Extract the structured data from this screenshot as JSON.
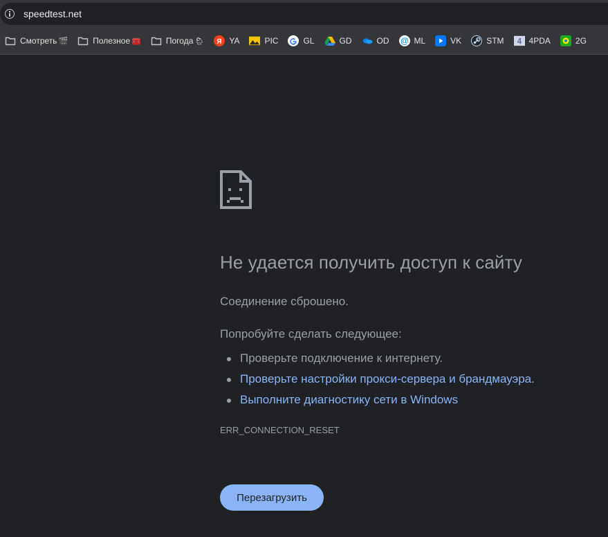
{
  "omnibox": {
    "url": "speedtest.net"
  },
  "bookmarks": [
    {
      "label": "Смотреть",
      "emoji": "🎬",
      "icon": "folder-icon"
    },
    {
      "label": "Полезное",
      "emoji": "🧰",
      "icon": "folder-icon"
    },
    {
      "label": "Погода",
      "emoji": "🌦",
      "icon": "folder-icon"
    },
    {
      "label": "YA",
      "icon": "yandex-icon",
      "color": "#fc3f1d"
    },
    {
      "label": "PIC",
      "icon": "picture-icon",
      "color": "#f5c400"
    },
    {
      "label": "GL",
      "icon": "google-icon",
      "color": "#4285f4"
    },
    {
      "label": "GD",
      "icon": "google-drive-icon",
      "color": "#0f9d58"
    },
    {
      "label": "OD",
      "icon": "onedrive-icon",
      "color": "#0a84ff"
    },
    {
      "label": "ML",
      "icon": "mail-icon",
      "color": "#168de2"
    },
    {
      "label": "VK",
      "icon": "vk-icon",
      "color": "#0077ff"
    },
    {
      "label": "STM",
      "icon": "steam-icon",
      "color": "#c7d5e0"
    },
    {
      "label": "4PDA",
      "icon": "4pda-icon",
      "color": "#d0d8e8"
    },
    {
      "label": "2G",
      "icon": "2gis-icon",
      "color": "#19aa1e"
    }
  ],
  "error": {
    "title": "Не удается получить доступ к сайту",
    "subtitle": "Соединение сброшено.",
    "try_heading": "Попробуйте сделать следующее:",
    "suggestions": [
      {
        "text": "Проверьте подключение к интернету.",
        "link": false
      },
      {
        "text": "Проверьте настройки прокси-сервера и брандмауэра.",
        "link": true
      },
      {
        "text": "Выполните диагностику сети в Windows",
        "link": true
      }
    ],
    "code": "ERR_CONNECTION_RESET",
    "reload_label": "Перезагрузить"
  },
  "colors": {
    "background": "#202124",
    "text": "#9aa0a6",
    "link": "#8ab4f8",
    "button": "#8ab4f8"
  }
}
